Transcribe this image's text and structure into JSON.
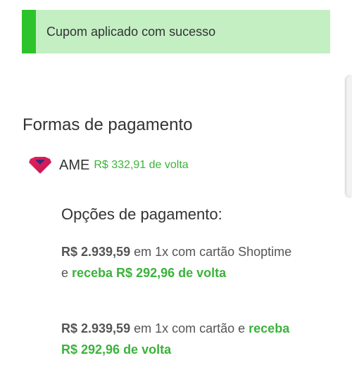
{
  "banner": {
    "message": "Cupom aplicado com sucesso",
    "accent_color": "#2cc42a",
    "background_color": "#c4efc3"
  },
  "payment": {
    "title": "Formas de pagamento",
    "ame": {
      "icon": "ame-heart-logo-icon",
      "name": "AME",
      "cashback": "R$ 332,91 de volta"
    },
    "options_title": "Opções de pagamento:",
    "options": [
      {
        "price": "R$ 2.939,59",
        "middle": " em 1x com cartão Shoptime e ",
        "cashback": "receba R$ 292,96 de volta"
      },
      {
        "price": "R$ 2.939,59",
        "middle": " em 1x com cartão e ",
        "cashback": "receba R$ 292,96 de volta"
      }
    ]
  },
  "colors": {
    "text": "#333333",
    "cashback_green": "#3bb33b"
  }
}
